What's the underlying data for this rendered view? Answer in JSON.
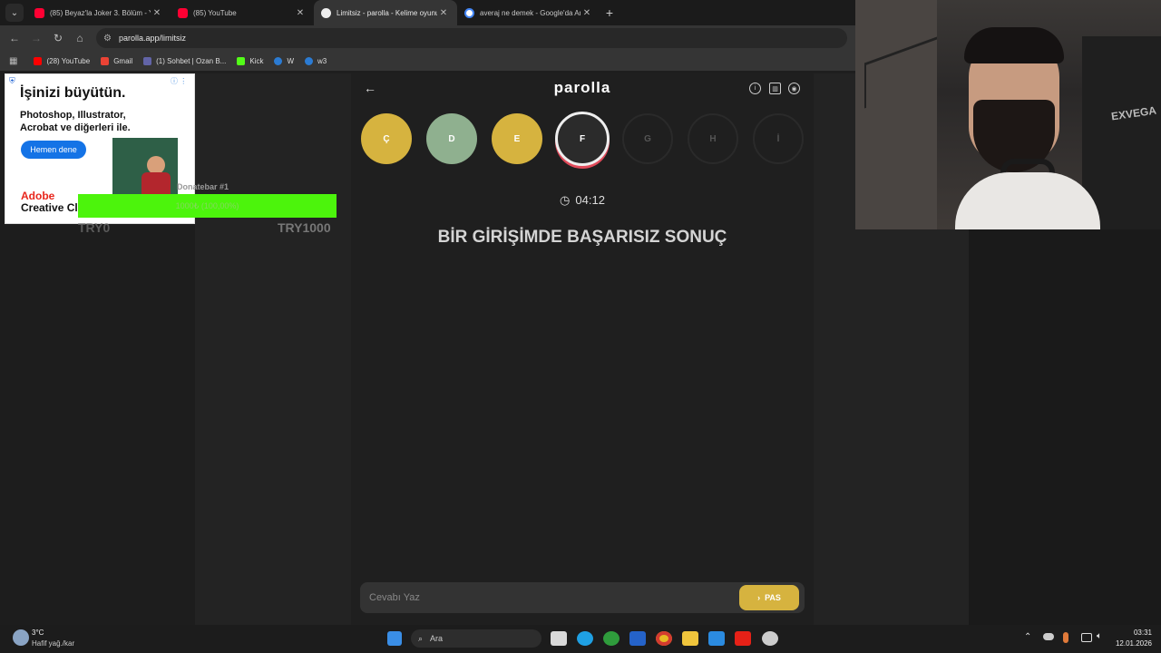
{
  "tabs": [
    {
      "title": "(85) Beyaz'la Joker 3. Bölüm - Y",
      "favicon": "youtube",
      "active": false
    },
    {
      "title": "(85) YouTube",
      "favicon": "youtube",
      "active": false
    },
    {
      "title": "Limitsiz - parolla - Kelime oyunu",
      "favicon": "parolla",
      "active": true
    },
    {
      "title": "averaj ne demek - Google'da Ar",
      "favicon": "google",
      "active": false
    }
  ],
  "toolbar": {
    "url": "parolla.app/limitsiz"
  },
  "bookmarks": [
    {
      "label": "(28) YouTube",
      "color": "#ff0000"
    },
    {
      "label": "Gmail",
      "color": "#ea4335"
    },
    {
      "label": "(1) Sohbet | Ozan B...",
      "color": "#6264a7"
    },
    {
      "label": "Kick",
      "color": "#53fc18"
    },
    {
      "label": "W",
      "color": "#2b7bd3"
    },
    {
      "label": "w3",
      "color": "#2b7bd3"
    }
  ],
  "ad": {
    "headline": "İşinizi büyütün.",
    "subtext": "Photoshop, Illustrator, Acrobat ve diğerleri ile.",
    "cta": "Hemen dene",
    "brand_line1": "Adobe",
    "brand_line2": "Creative Cl"
  },
  "donate": {
    "title": "Donatebar #1",
    "progress_label": "1000₺ (100,00%)",
    "progress": 1.0,
    "min": "TRY0",
    "max": "TRY1000"
  },
  "app": {
    "logo": "parolla",
    "letters": [
      {
        "char": "Ç",
        "state": "wrong"
      },
      {
        "char": "D",
        "state": "correct"
      },
      {
        "char": "E",
        "state": "wrong"
      },
      {
        "char": "F",
        "state": "current"
      },
      {
        "char": "G",
        "state": "pending"
      },
      {
        "char": "H",
        "state": "pending"
      },
      {
        "char": "İ",
        "state": "pending"
      }
    ],
    "timer": "04:12",
    "question": "BİR GİRİŞİMDE BAŞARISIZ SONUÇ",
    "answer_placeholder": "Cevabı Yaz",
    "pass_label": "PAS"
  },
  "taskbar": {
    "weather_temp": "3°C",
    "weather_desc": "Hafif yağ./kar",
    "search_label": "Ara",
    "time": "03:31",
    "date": "12.01.2026"
  },
  "colors": {
    "wrong": "#d6b33f",
    "correct": "#8fb08f",
    "donate_fill": "#4cf40c"
  }
}
